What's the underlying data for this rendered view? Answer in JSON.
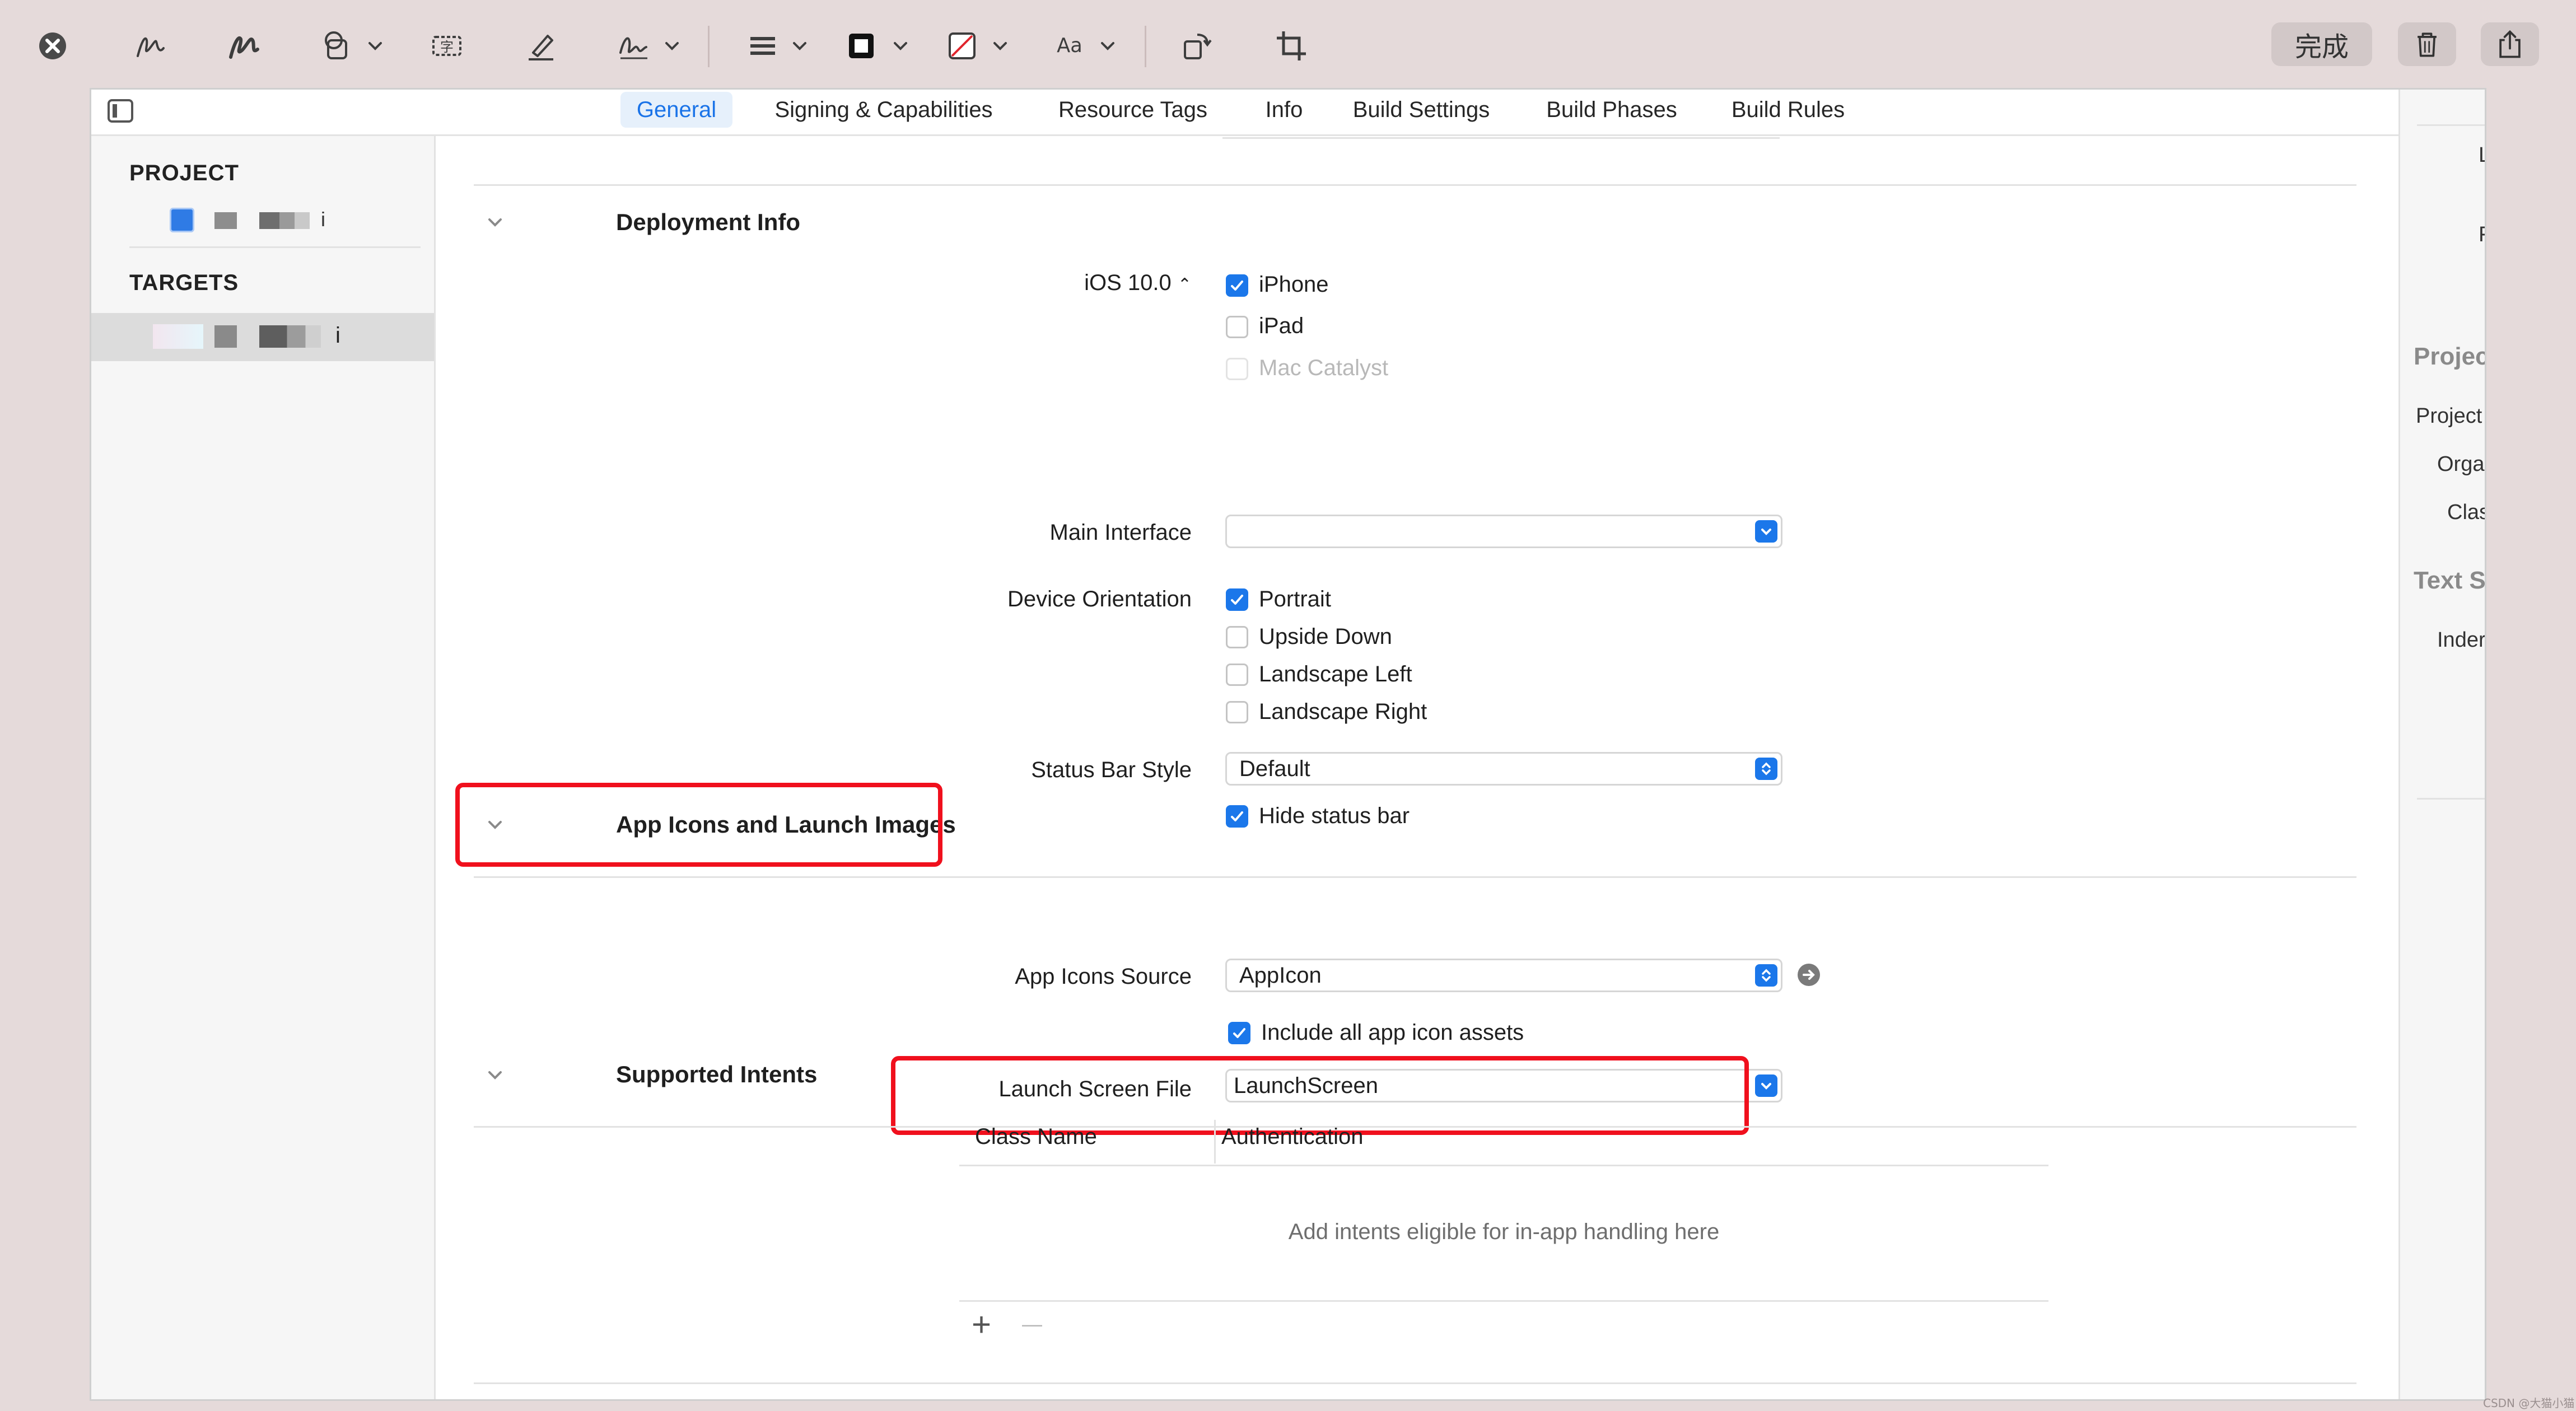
{
  "toolbar": {
    "done_label": "完成"
  },
  "tabs": [
    {
      "label": "General",
      "active": true
    },
    {
      "label": "Signing & Capabilities"
    },
    {
      "label": "Resource Tags"
    },
    {
      "label": "Info"
    },
    {
      "label": "Build Settings"
    },
    {
      "label": "Build Phases"
    },
    {
      "label": "Build Rules"
    }
  ],
  "sidebar": {
    "project_header": "PROJECT",
    "project_item_suffix": "i",
    "targets_header": "TARGETS",
    "target_item_suffix": "i"
  },
  "deployment": {
    "title": "Deployment Info",
    "ios_version": "iOS 10.0",
    "devices": [
      {
        "label": "iPhone",
        "state": "checked"
      },
      {
        "label": "iPad",
        "state": "unchecked"
      },
      {
        "label": "Mac Catalyst",
        "state": "disabled"
      }
    ],
    "main_interface_label": "Main Interface",
    "main_interface_value": "",
    "orientation_label": "Device Orientation",
    "orientations": [
      {
        "label": "Portrait",
        "state": "checked"
      },
      {
        "label": "Upside Down",
        "state": "unchecked"
      },
      {
        "label": "Landscape Left",
        "state": "unchecked"
      },
      {
        "label": "Landscape Right",
        "state": "unchecked"
      }
    ],
    "status_bar_label": "Status Bar Style",
    "status_bar_value": "Default",
    "hide_status_bar_label": "Hide status bar",
    "hide_status_bar_state": "checked"
  },
  "app_icons": {
    "title": "App Icons and Launch Images",
    "source_label": "App Icons Source",
    "source_value": "AppIcon",
    "include_all_label": "Include all app icon assets",
    "include_all_state": "checked",
    "launch_screen_label": "Launch Screen File",
    "launch_screen_value": "LaunchScreen"
  },
  "intents": {
    "title": "Supported Intents",
    "col_class": "Class Name",
    "col_auth": "Authentication",
    "empty_text": "Add intents eligible for in-app handling here",
    "add_label": "+",
    "remove_label": "—"
  },
  "inspector": {
    "row1": "L",
    "row2": "F",
    "section1": "Projec",
    "s1_row1": "Project",
    "s1_row2": "Orga",
    "s1_row3": "Clas",
    "section2": "Text S",
    "s2_row1": "Inder"
  },
  "watermark": "CSDN @大猫小猫",
  "colors": {
    "accent": "#1b77ea",
    "highlight_box": "#f0101d",
    "toolbar_bg": "#e5dada"
  }
}
